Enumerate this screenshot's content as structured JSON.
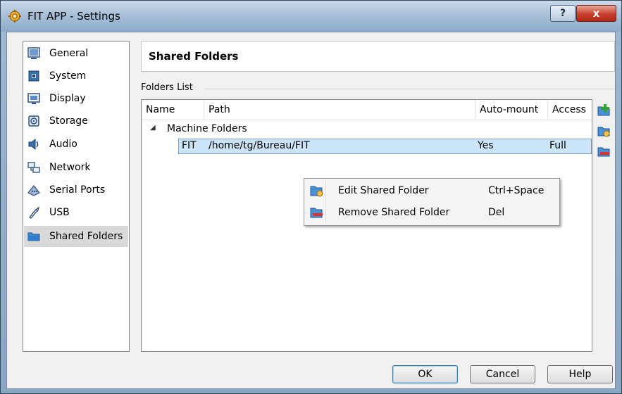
{
  "window": {
    "title": "FIT APP - Settings",
    "help_label": "?",
    "close_label": "x"
  },
  "sidebar": {
    "items": [
      {
        "label": "General",
        "icon": "general-icon"
      },
      {
        "label": "System",
        "icon": "system-icon"
      },
      {
        "label": "Display",
        "icon": "display-icon"
      },
      {
        "label": "Storage",
        "icon": "storage-icon"
      },
      {
        "label": "Audio",
        "icon": "audio-icon"
      },
      {
        "label": "Network",
        "icon": "network-icon"
      },
      {
        "label": "Serial Ports",
        "icon": "serial-ports-icon"
      },
      {
        "label": "USB",
        "icon": "usb-icon"
      },
      {
        "label": "Shared Folders",
        "icon": "shared-folders-icon",
        "selected": true
      }
    ]
  },
  "main": {
    "page_title": "Shared Folders",
    "group_label": "Folders List",
    "columns": [
      "Name",
      "Path",
      "Auto-mount",
      "Access"
    ],
    "tree": {
      "group_name": "Machine Folders",
      "rows": [
        {
          "name": "FIT",
          "path": "/home/tg/Bureau/FIT",
          "auto_mount": "Yes",
          "access": "Full"
        }
      ]
    }
  },
  "context_menu": {
    "items": [
      {
        "label": "Edit Shared Folder",
        "shortcut": "Ctrl+Space"
      },
      {
        "label": "Remove Shared Folder",
        "shortcut": "Del"
      }
    ]
  },
  "buttons": {
    "ok": "OK",
    "cancel": "Cancel",
    "help": "Help"
  }
}
